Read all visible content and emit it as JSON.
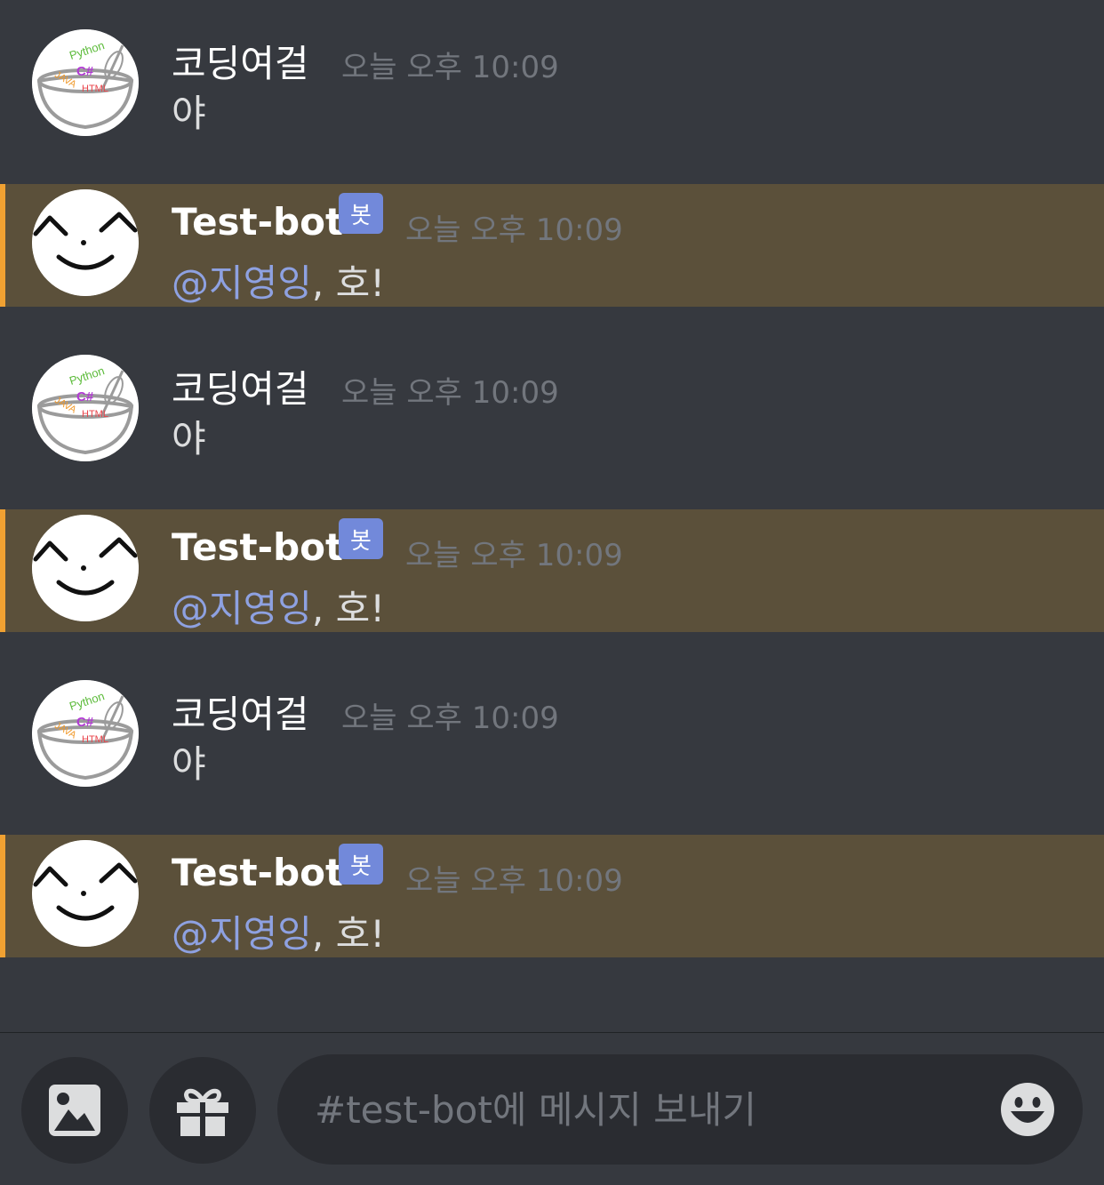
{
  "messages": [
    {
      "kind": "user",
      "author": "코딩여걸",
      "timestamp": "오늘 오후 10:09",
      "text": "야"
    },
    {
      "kind": "bot",
      "author": "Test-bot",
      "tag": "봇",
      "timestamp": "오늘 오후 10:09",
      "mention": "@지영잉",
      "text": ", 호!"
    },
    {
      "kind": "user",
      "author": "코딩여걸",
      "timestamp": "오늘 오후 10:09",
      "text": "야"
    },
    {
      "kind": "bot",
      "author": "Test-bot",
      "tag": "봇",
      "timestamp": "오늘 오후 10:09",
      "mention": "@지영잉",
      "text": ", 호!"
    },
    {
      "kind": "user",
      "author": "코딩여걸",
      "timestamp": "오늘 오후 10:09",
      "text": "야"
    },
    {
      "kind": "bot",
      "author": "Test-bot",
      "tag": "봇",
      "timestamp": "오늘 오후 10:09",
      "mention": "@지영잉",
      "text": ", 호!"
    }
  ],
  "user_avatar_logo": {
    "line1": "Python",
    "line2": "C#",
    "line3a": "JAVA",
    "line3b": "HTML"
  },
  "composer": {
    "placeholder": "#test-bot에 메시지 보내기",
    "value": "",
    "image_icon": "image-icon",
    "gift_icon": "gift-icon",
    "emoji_icon": "emoji-icon"
  },
  "colors": {
    "background": "#36393f",
    "bot_highlight": "#5b503a",
    "bot_highlight_bar": "#f0a132",
    "bot_tag": "#7289da",
    "mention": "#8ea1e1",
    "timestamp": "#72767d"
  }
}
